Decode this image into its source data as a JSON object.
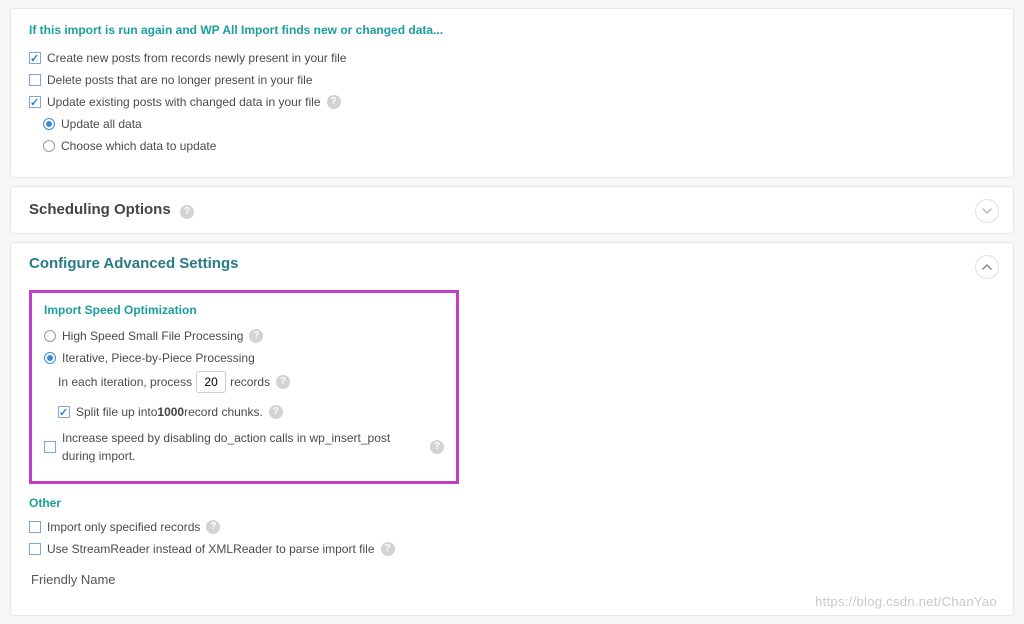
{
  "importRules": {
    "heading": "If this import is run again and WP All Import finds new or changed data...",
    "createNew": "Create new posts from records newly present in your file",
    "deleteMissing": "Delete posts that are no longer present in your file",
    "updateExisting": "Update existing posts with changed data in your file",
    "updateAll": "Update all data",
    "chooseWhich": "Choose which data to update"
  },
  "scheduling": {
    "title": "Scheduling Options"
  },
  "advanced": {
    "title": "Configure Advanced Settings",
    "speed": {
      "heading": "Import Speed Optimization",
      "highSpeed": "High Speed Small File Processing",
      "iterative": "Iterative, Piece-by-Piece Processing",
      "iterPrefix": "In each iteration, process",
      "iterValue": "20",
      "iterSuffix": "records",
      "splitPrefix": "Split file up into ",
      "splitBold": "1000",
      "splitSuffix": " record chunks.",
      "disableDoAction": "Increase speed by disabling do_action calls in wp_insert_post during import."
    },
    "other": {
      "heading": "Other",
      "onlySpecified": "Import only specified records",
      "streamReader": "Use StreamReader instead of XMLReader to parse import file"
    },
    "friendly": "Friendly Name"
  },
  "watermark": "https://blog.csdn.net/ChanYao"
}
